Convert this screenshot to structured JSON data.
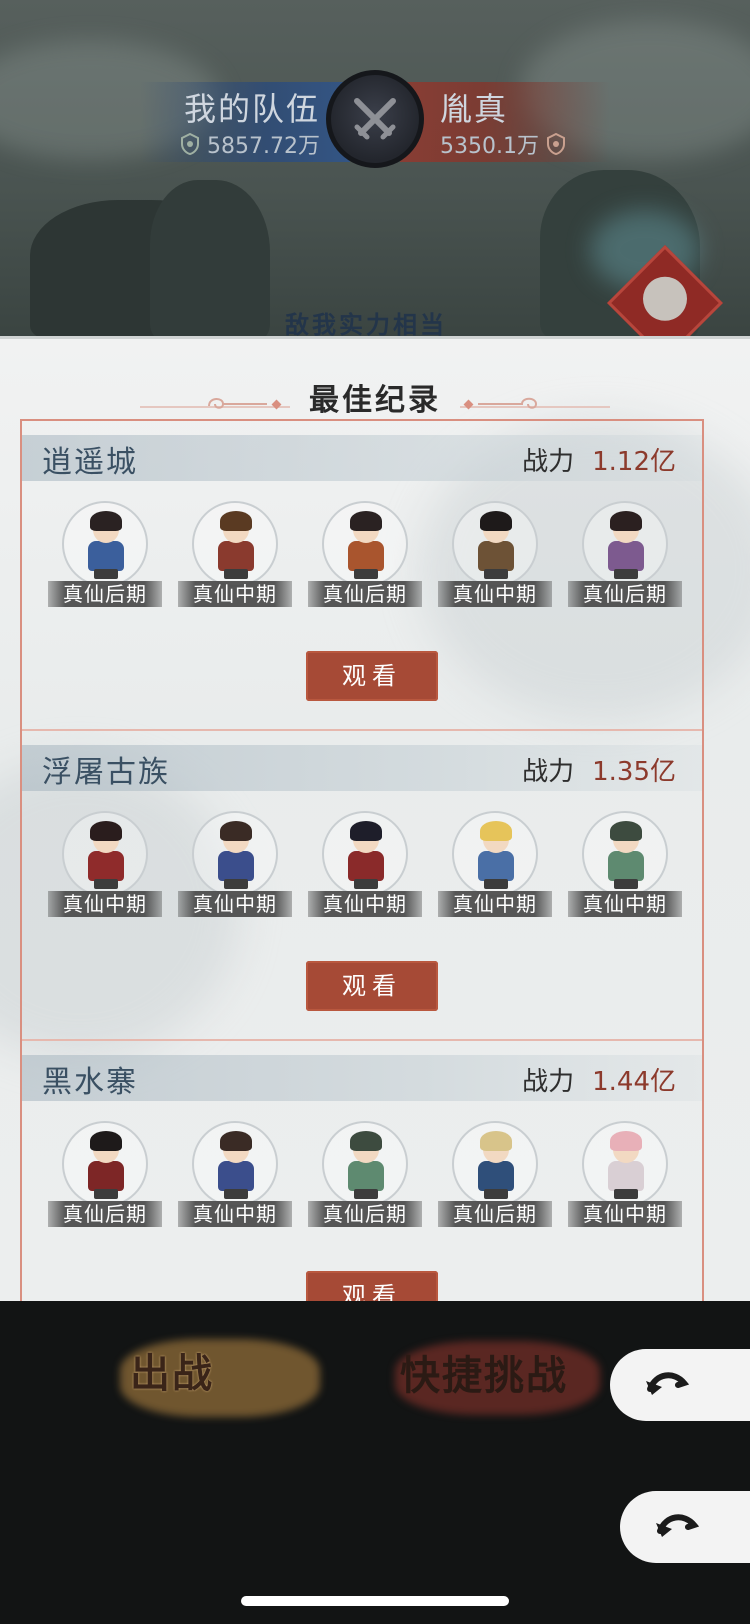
{
  "battle": {
    "my_team_name": "我的队伍",
    "my_power": "5857.72万",
    "enemy_name": "胤真",
    "enemy_power": "5350.1万",
    "partial_caption": "敌我实力相当"
  },
  "modal": {
    "title": "最佳纪录",
    "power_label": "战力",
    "watch_label": "观看",
    "records": [
      {
        "name": "逍遥城",
        "power": "1.12亿",
        "heroes": [
          {
            "rank": "真仙后期",
            "body_color": "#3b5f9c",
            "hair_color": "#2a2222"
          },
          {
            "rank": "真仙中期",
            "body_color": "#8a3a2e",
            "hair_color": "#5a3a22"
          },
          {
            "rank": "真仙后期",
            "body_color": "#a9552e",
            "hair_color": "#2a2222"
          },
          {
            "rank": "真仙中期",
            "body_color": "#6d5236",
            "hair_color": "#1e1a1a"
          },
          {
            "rank": "真仙后期",
            "body_color": "#7d5a8f",
            "hair_color": "#2b2020"
          }
        ]
      },
      {
        "name": "浮屠古族",
        "power": "1.35亿",
        "heroes": [
          {
            "rank": "真仙中期",
            "body_color": "#8f2b2b",
            "hair_color": "#2a1d1d"
          },
          {
            "rank": "真仙中期",
            "body_color": "#3b4e8c",
            "hair_color": "#3a2b25"
          },
          {
            "rank": "真仙中期",
            "body_color": "#8a2a2a",
            "hair_color": "#1e1e2a"
          },
          {
            "rank": "真仙中期",
            "body_color": "#4a6fa6",
            "hair_color": "#e6c45a"
          },
          {
            "rank": "真仙中期",
            "body_color": "#5e8a70",
            "hair_color": "#3d4b3f"
          }
        ]
      },
      {
        "name": "黑水寨",
        "power": "1.44亿",
        "heroes": [
          {
            "rank": "真仙后期",
            "body_color": "#7d2626",
            "hair_color": "#1e1a1a"
          },
          {
            "rank": "真仙中期",
            "body_color": "#3b4e8c",
            "hair_color": "#3a2b25"
          },
          {
            "rank": "真仙后期",
            "body_color": "#5e8a70",
            "hair_color": "#3d4b3f"
          },
          {
            "rank": "真仙后期",
            "body_color": "#2f4f7a",
            "hair_color": "#d8c48a"
          },
          {
            "rank": "真仙中期",
            "body_color": "#d9cfd4",
            "hair_color": "#e8b0b8"
          }
        ]
      }
    ]
  },
  "bottom": {
    "fight_label": "出战",
    "quick_label": "快捷挑战"
  },
  "colors": {
    "accent_red": "#a64a36",
    "power_value": "#8c3a2c",
    "record_name": "#3a5063"
  },
  "icons": [
    "crossed-swords-icon",
    "power-icon",
    "back-arrow-icon",
    "enemy-emblem-icon"
  ]
}
